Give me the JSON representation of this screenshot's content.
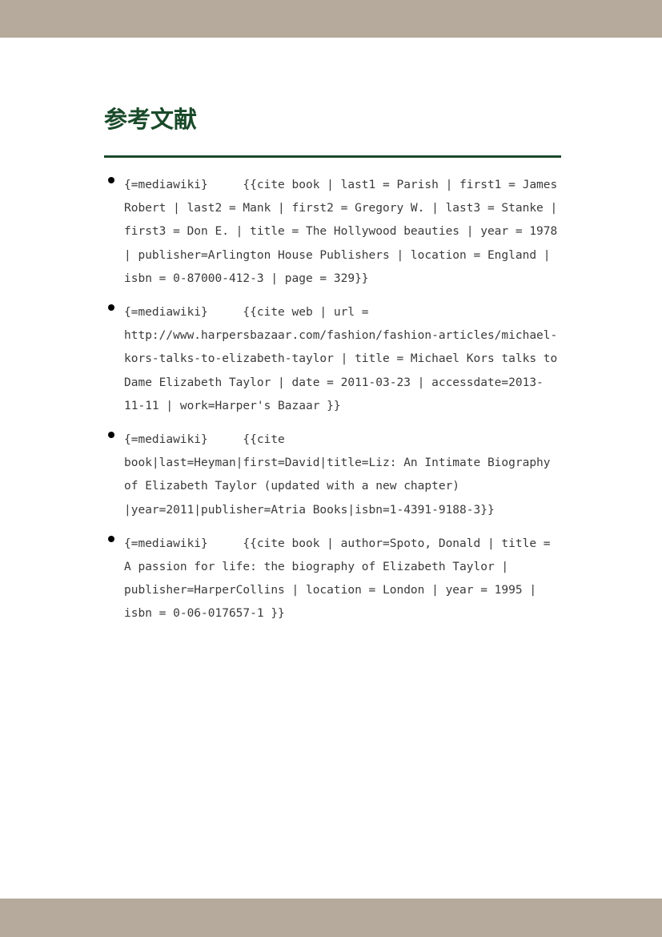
{
  "page": {
    "heading": "参考文献",
    "colors": {
      "band": "#b5aa9c",
      "heading": "#1a4a2a",
      "rule": "#1a4a2a",
      "text": "#3a3a3a"
    }
  },
  "references": [
    {
      "text": "{=mediawiki}     {{cite book | last1 = Parish | first1 = James Robert | last2 = Mank | first2 = Gregory W. | last3 = Stanke | first3 = Don E. | title = The Hollywood beauties | year = 1978 | publisher=Arlington House Publishers | location = England | isbn = 0-87000-412-3 | page = 329}}"
    },
    {
      "text": "{=mediawiki}     {{cite web | url = http://www.harpersbazaar.com/fashion/fashion-articles/michael-kors-talks-to-elizabeth-taylor | title = Michael Kors talks to Dame Elizabeth Taylor | date = 2011-03-23 | accessdate=2013-11-11 | work=Harper's Bazaar }}"
    },
    {
      "text": "{=mediawiki}     {{cite book|last=Heyman|first=David|title=Liz: An Intimate Biography of Elizabeth Taylor (updated with a new chapter) |year=2011|publisher=Atria Books|isbn=1-4391-9188-3}}"
    },
    {
      "text": "{=mediawiki}     {{cite book | author=Spoto, Donald | title = A passion for life: the biography of Elizabeth Taylor | publisher=HarperCollins | location = London | year = 1995 | isbn = 0-06-017657-1 }}"
    }
  ]
}
